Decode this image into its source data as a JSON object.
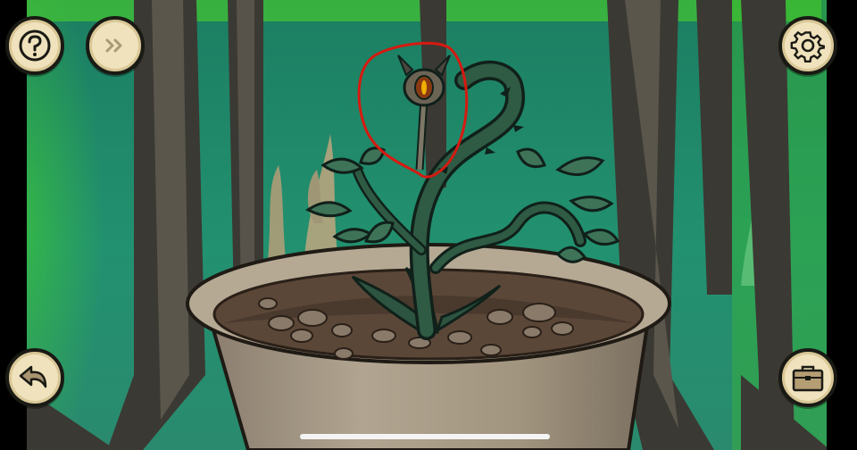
{
  "scene": {
    "name": "plant-pot-closeup",
    "colors": {
      "background_green": "#1f8a6a",
      "glass_glow": "#37d11f",
      "pot": "#a89a88",
      "soil": "#5a4637",
      "stem": "#2f5a43",
      "annotation_circle": "#d61a10"
    }
  },
  "hud": {
    "help_icon": "question-mark-icon",
    "skip_icon": "fast-forward-icon",
    "settings_icon": "gear-icon",
    "back_icon": "curved-back-arrow-icon",
    "inventory_icon": "briefcase-icon"
  }
}
